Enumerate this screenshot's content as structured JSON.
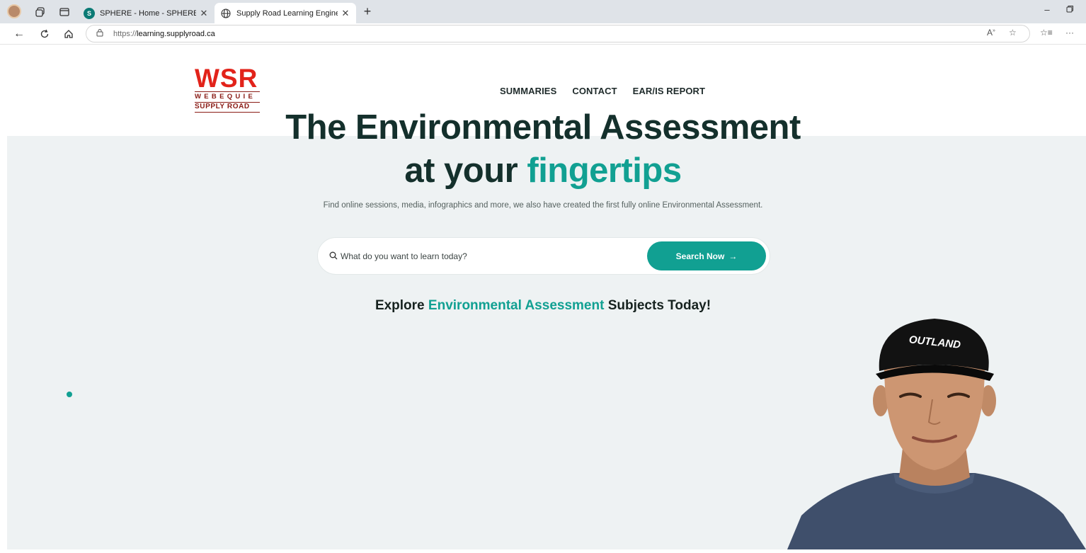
{
  "browser": {
    "tabs": [
      {
        "title": "SPHERE - Home - SPHERE - Home",
        "favicon": "sharepoint-icon",
        "active": false
      },
      {
        "title": "Supply Road Learning Engine – Th",
        "favicon": "globe-icon",
        "active": true
      }
    ],
    "url_scheme": "https://",
    "url_host": "learning.supplyroad.ca"
  },
  "site": {
    "logo": {
      "main": "WSR",
      "line1": "WEBEQUIE",
      "line2": "SUPPLY ROAD"
    },
    "nav": [
      "SUMMARIES",
      "CONTACT",
      "EAR/IS REPORT"
    ]
  },
  "hero": {
    "headline_line1": "The Environmental Assessment",
    "headline_line2_plain": "at your",
    "headline_line2_accent": "fingertips",
    "subtitle": "Find online sessions, media, infographics and more, we also have created the first fully online Environmental Assessment.",
    "search_placeholder": "What do you want to learn today?",
    "search_button": "Search Now",
    "explore_pre": "Explore",
    "explore_accent": "Environmental Assessment",
    "explore_post": "Subjects Today!"
  },
  "presenter": {
    "cap_text": "OUTLAND"
  },
  "colors": {
    "accent": "#11a092",
    "brand_red": "#e2231a",
    "hero_bg": "#eef2f3",
    "headline": "#14302c"
  }
}
